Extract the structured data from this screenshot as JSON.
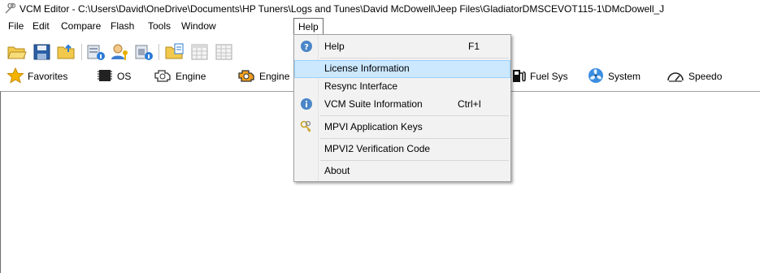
{
  "title_bar": {
    "title": "VCM Editor - C:\\Users\\David\\OneDrive\\Documents\\HP Tuners\\Logs and Tunes\\David McDowell\\Jeep Files\\GladiatorDMSCEVOT115-1\\DMcDowell_J"
  },
  "menu_bar": {
    "items": [
      {
        "label": "File"
      },
      {
        "label": "Edit"
      },
      {
        "label": "Compare"
      },
      {
        "label": "Flash"
      },
      {
        "label": "Tools"
      },
      {
        "label": "Window"
      },
      {
        "label": "Help",
        "open": true
      }
    ]
  },
  "toolbar": {
    "icons": [
      "open-folder-icon",
      "save-icon",
      "folder-up-icon",
      "vehicle-info-icon",
      "user-key-icon",
      "chip-info-icon",
      "open-file-icon",
      "calendar-grid-icon",
      "table-grid-icon"
    ]
  },
  "nav_bar": {
    "items": [
      {
        "label": "Favorites",
        "icon": "star-icon"
      },
      {
        "label": "OS",
        "icon": "chip-icon"
      },
      {
        "label": "Engine",
        "icon": "engine-icon"
      },
      {
        "label": "Engine",
        "icon": "engine-icon"
      },
      {
        "label": "Fuel Sys",
        "icon": "fuel-pump-icon"
      },
      {
        "label": "System",
        "icon": "fan-icon"
      },
      {
        "label": "Speedo",
        "icon": "speedometer-icon"
      }
    ]
  },
  "help_menu": {
    "items": [
      {
        "label": "Help",
        "shortcut": "F1",
        "icon": "help-circle-icon"
      },
      {
        "label": "License Information",
        "shortcut": "",
        "highlighted": true
      },
      {
        "label": "Resync Interface",
        "shortcut": ""
      },
      {
        "label": "VCM Suite Information",
        "shortcut": "Ctrl+I",
        "icon": "info-circle-icon"
      },
      {
        "label": "MPVI Application Keys",
        "shortcut": "",
        "icon": "keys-icon"
      },
      {
        "label": "MPVI2 Verification Code",
        "shortcut": ""
      },
      {
        "label": "About",
        "shortcut": ""
      }
    ]
  },
  "colors": {
    "menu_highlight": "#cce8ff",
    "menu_highlight_border": "#99d1ff",
    "menu_background": "#f2f2f2"
  }
}
